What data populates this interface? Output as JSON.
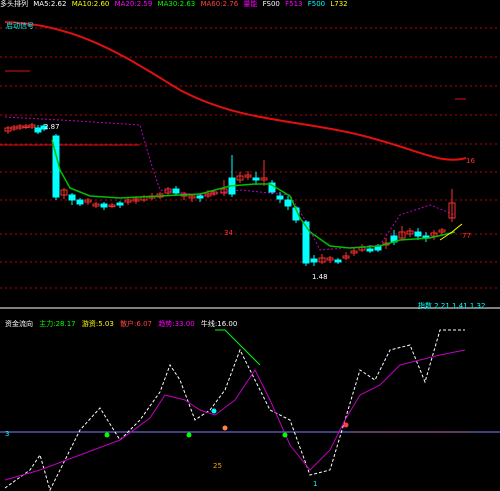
{
  "header": {
    "title": "多头排列",
    "items": [
      {
        "text": "MA5:2.62",
        "color": "#ffffff"
      },
      {
        "text": "MA10:2.60",
        "color": "#ffff00"
      },
      {
        "text": "MA20:2.59",
        "color": "#ff00ff"
      },
      {
        "text": "MA30:2.63",
        "color": "#00ff00"
      },
      {
        "text": "MA60:2.76",
        "color": "#ff4040"
      },
      {
        "text": "量能",
        "color": "#ff00ff"
      },
      {
        "text": "FS00",
        "color": "#ffffff"
      },
      {
        "text": "F513",
        "color": "#ff00ff"
      },
      {
        "text": "F500",
        "color": "#00ffff"
      },
      {
        "text": "L732",
        "color": "#ffff00"
      }
    ]
  },
  "main_panel": {
    "tag": "启动信号",
    "price_high_label": "2.87",
    "price_low_label": "1.48",
    "right_label_top": "16",
    "right_label_bottom": "77",
    "mid_label": "34"
  },
  "sub_panel": {
    "right_label": "指数 2.21 1.41 1.32",
    "legend": [
      {
        "text": "资金流向",
        "color": "#ffffff"
      },
      {
        "text": "主力:28.17",
        "color": "#00ff00"
      },
      {
        "text": "游资:5.03",
        "color": "#ffff00"
      },
      {
        "text": "散户:6.07",
        "color": "#ff4040"
      },
      {
        "text": "趋势:33.00",
        "color": "#ff00ff"
      },
      {
        "text": "牛线:16.00",
        "color": "#ffffff"
      }
    ],
    "mark_label_1": "3",
    "mark_label_2": "25",
    "mark_label_3": "1"
  },
  "colors": {
    "up": "#ff3030",
    "down": "#00ffff",
    "ma_red": "#e01010",
    "ma_green": "#00c000",
    "ma_purple": "#c000c0",
    "grid": "#c00000",
    "baseline": "#8080ff"
  }
}
